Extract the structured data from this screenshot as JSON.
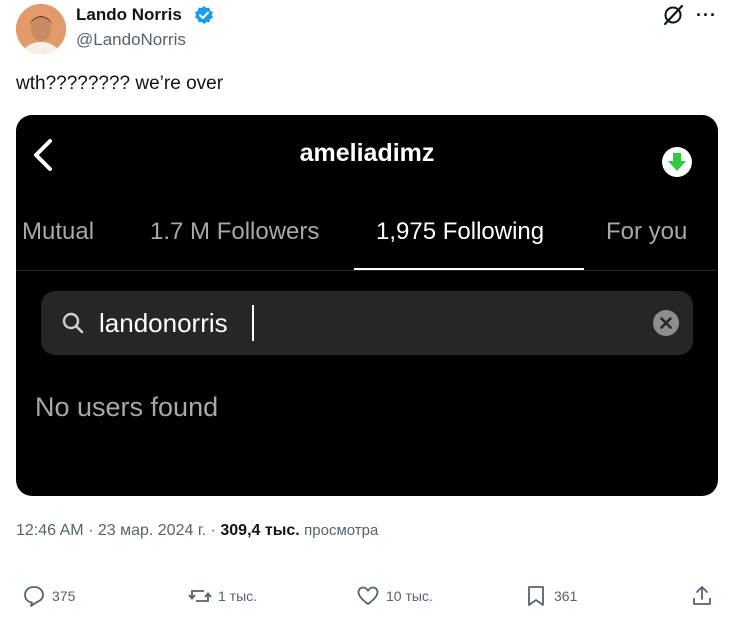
{
  "tweet": {
    "author_name": "Lando Norris",
    "author_handle": "@LandoNorris",
    "text": "wth???????? we’re over"
  },
  "screenshot": {
    "profile_name": "ameliadimz",
    "tabs": [
      {
        "label": "Mutual",
        "active": false
      },
      {
        "label": "1.7 M Followers",
        "active": false
      },
      {
        "label": "1,975 Following",
        "active": true
      },
      {
        "label": "For you",
        "active": false
      }
    ],
    "search_value": "landonorris",
    "empty_message": "No users found"
  },
  "meta": {
    "time": "12:46 AM",
    "date": "23 мар. 2024 г.",
    "views_count": "309,4 тыс.",
    "views_label": "просмотра",
    "separator": "·"
  },
  "actions": {
    "replies": "375",
    "reposts": "1 тыс.",
    "likes": "10 тыс.",
    "bookmarks": "361"
  },
  "icons": [
    "verified-badge-icon",
    "grok-icon",
    "more-icon",
    "back-icon",
    "download-icon",
    "search-icon",
    "clear-icon",
    "reply-icon",
    "repost-icon",
    "like-icon",
    "bookmark-icon",
    "share-icon"
  ],
  "colors": {
    "verified": "#1d9bf0",
    "download_badge": "#2ecc40",
    "muted_text": "#536471"
  }
}
